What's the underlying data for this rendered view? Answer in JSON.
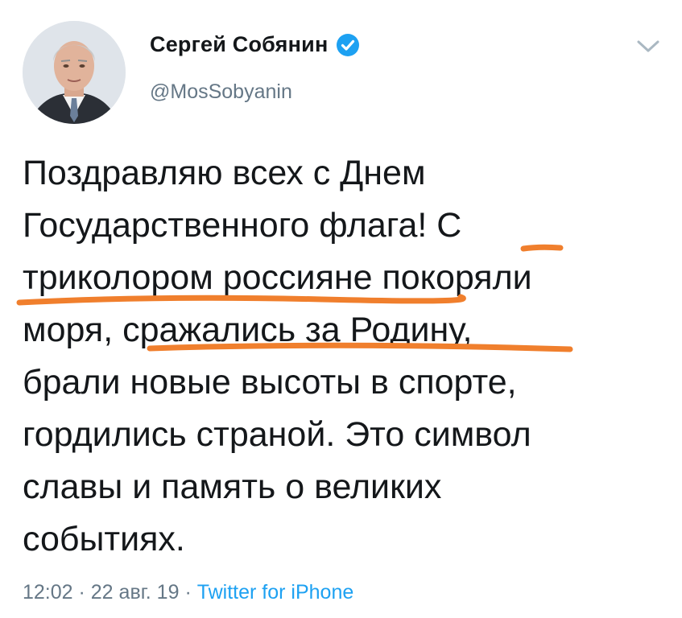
{
  "author": {
    "name": "Сергей Собянин",
    "handle": "@MosSobyanin",
    "verified": true
  },
  "tweet": {
    "lines": [
      "Поздравляю всех с Днем",
      "Государственного флага! С",
      "триколором россияне покоряли",
      "моря, сражались за Родину,",
      "брали новые высоты в спорте,",
      "гордились страной. Это символ",
      "славы и память о великих",
      "событиях."
    ]
  },
  "meta": {
    "time": "12:02",
    "separator1": " · ",
    "date": "22 авг. 19",
    "separator2": " · ",
    "source": "Twitter for iPhone"
  },
  "icons": {
    "verified": "verified-badge-icon",
    "menu": "chevron-down-icon"
  },
  "colors": {
    "text": "#14171a",
    "secondary": "#657786",
    "link": "#1da1f2",
    "highlight": "#f07f2d"
  }
}
